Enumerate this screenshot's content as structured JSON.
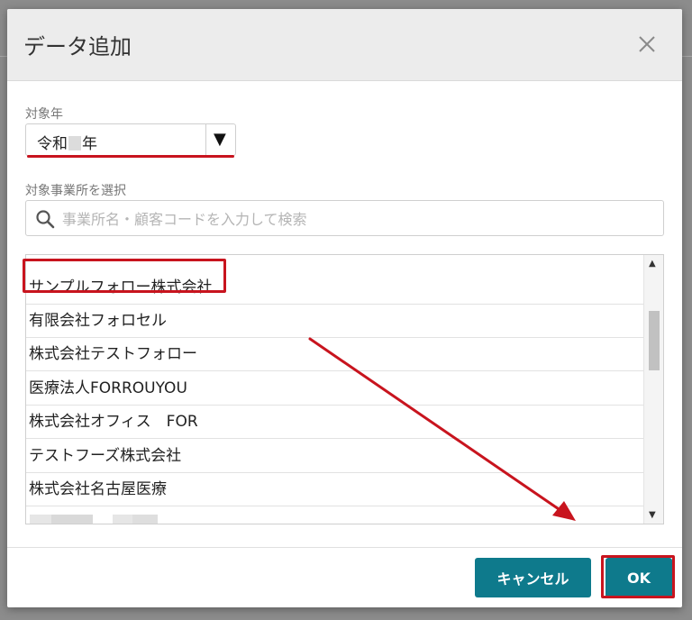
{
  "dialog": {
    "title": "データ追加",
    "close_icon": "close-icon"
  },
  "year_field": {
    "label": "対象年",
    "value_prefix": "令和",
    "value_suffix": "年",
    "arrow": "▼"
  },
  "office_field": {
    "label": "対象事業所を選択",
    "search_placeholder": "事業所名・顧客コードを入力して検索",
    "search_icon": "search-icon"
  },
  "office_list": {
    "items": [
      "サンプルフォロー株式会社",
      "有限会社フォロセル",
      "株式会社テストフォロー",
      "医療法人FORROUYOU",
      "株式会社オフィス　FOR",
      "テストフーズ株式会社",
      "株式会社名古屋医療"
    ],
    "scroll_up": "▲",
    "scroll_down": "▼"
  },
  "footer": {
    "cancel_label": "キャンセル",
    "ok_label": "OK"
  },
  "colors": {
    "accent": "#0e7a8c",
    "annotation_red": "#c8141e"
  }
}
